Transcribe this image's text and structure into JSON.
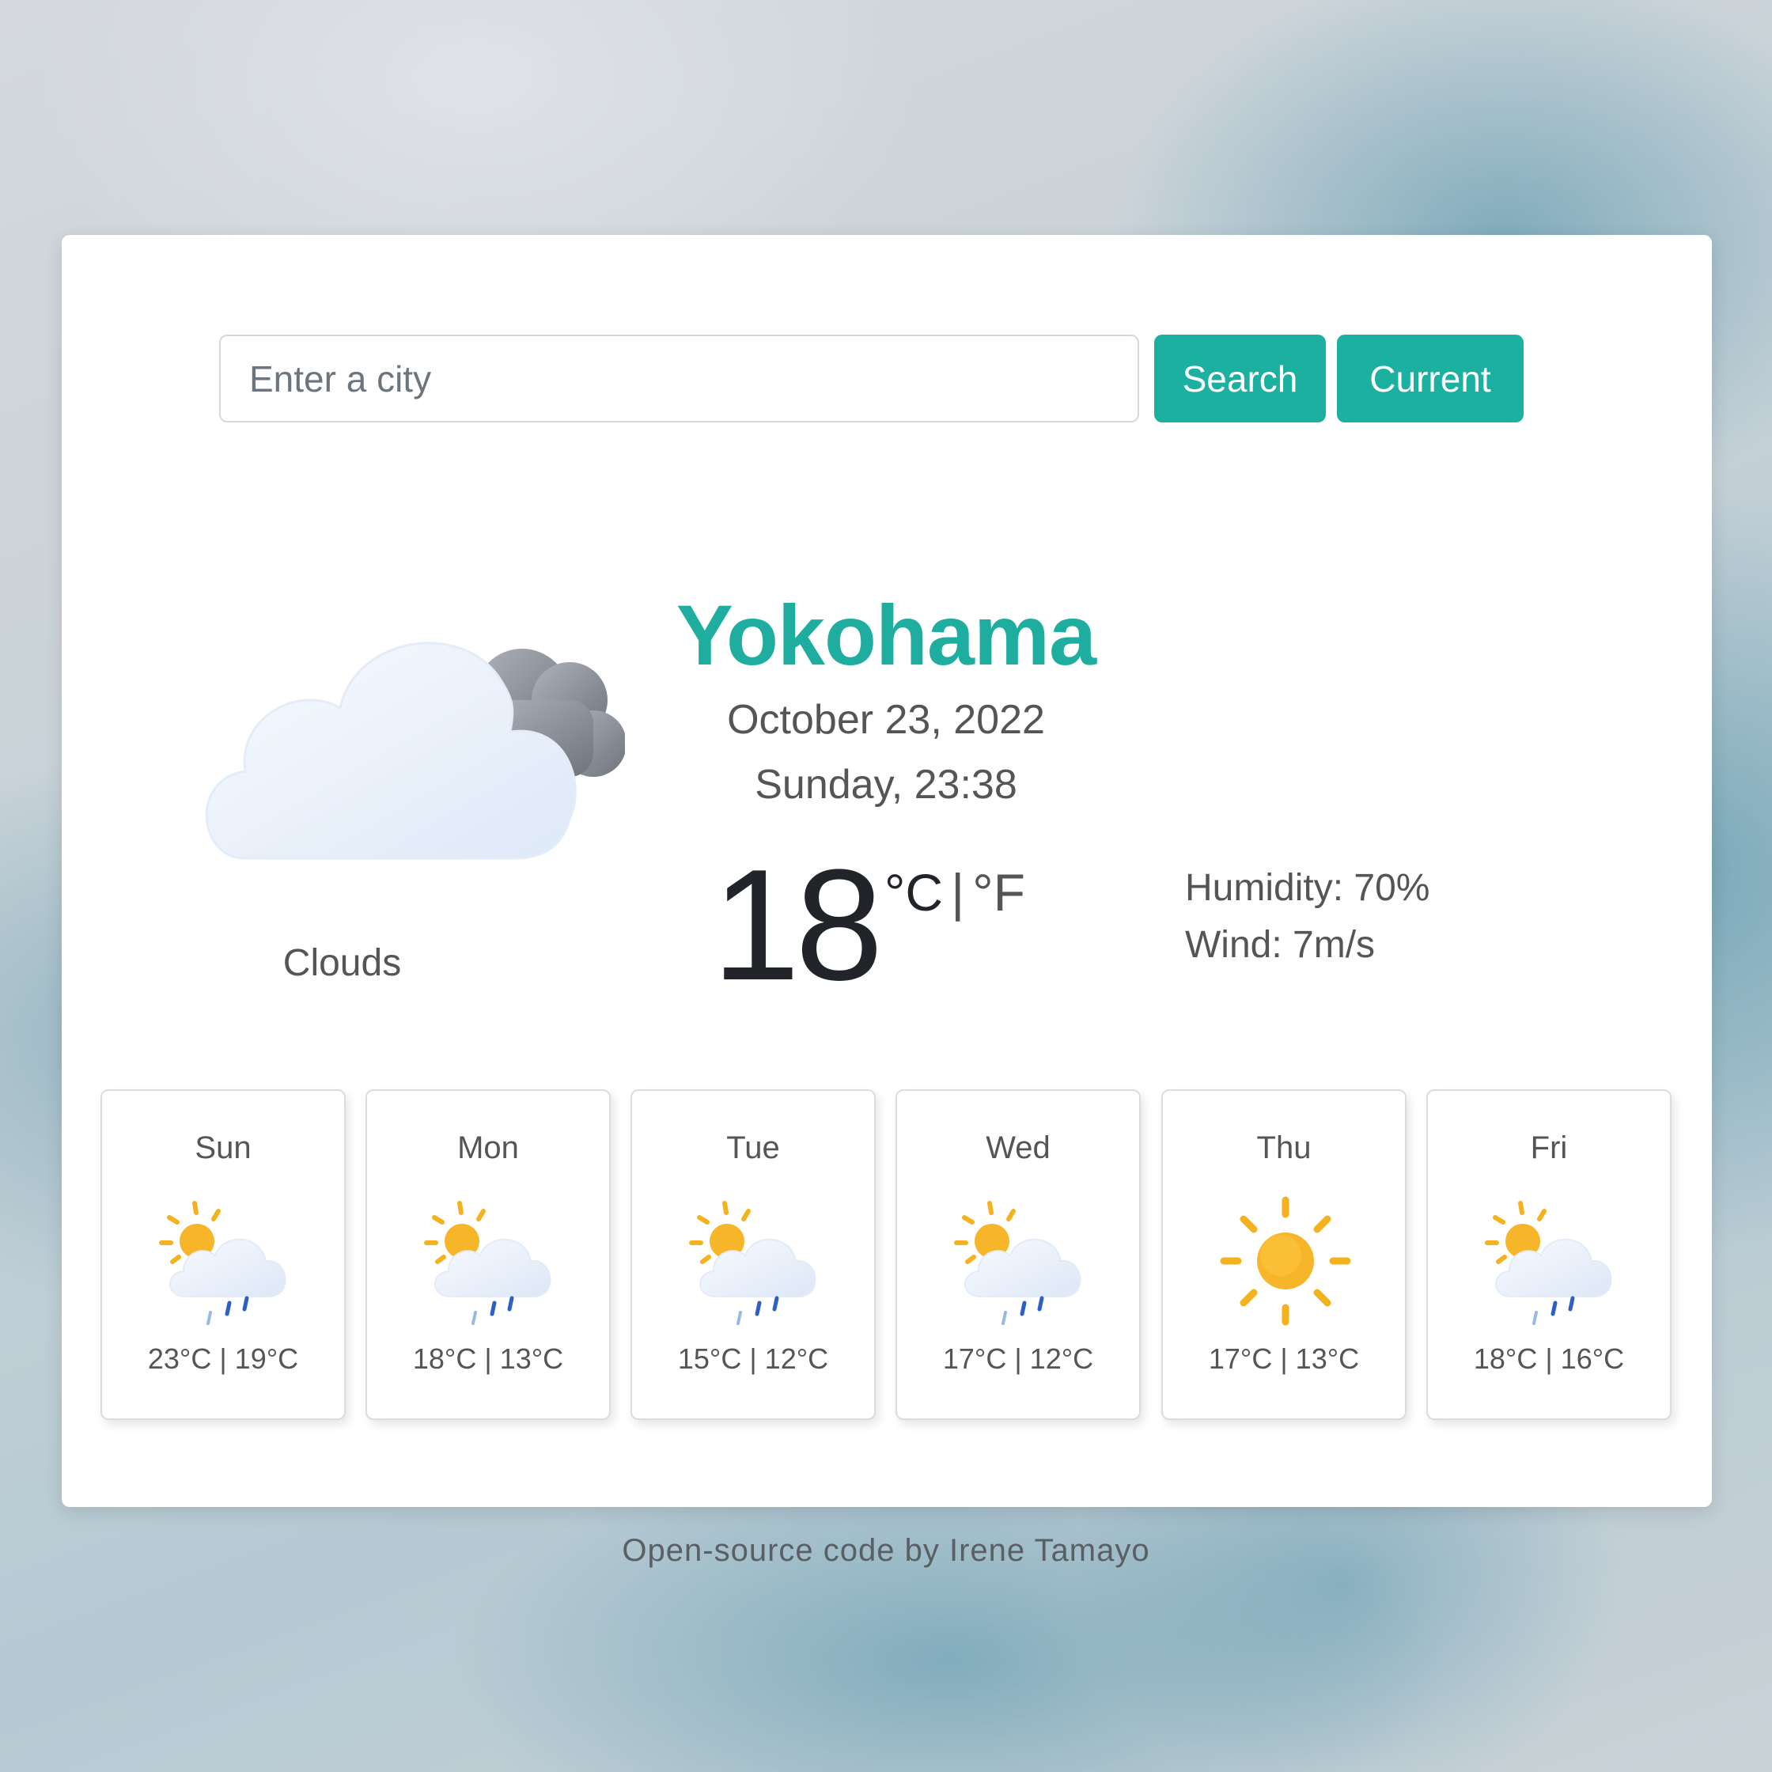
{
  "search": {
    "placeholder": "Enter a city",
    "search_label": "Search",
    "current_label": "Current"
  },
  "current": {
    "icon": "clouds-icon",
    "description": "Clouds",
    "city": "Yokohama",
    "date": "October 23, 2022",
    "day_time": "Sunday, 23:38",
    "temperature": "18",
    "unit_c": "°C",
    "separator": "|",
    "unit_f": "°F",
    "humidity": "Humidity: 70%",
    "wind": "Wind: 7m/s"
  },
  "forecast": [
    {
      "day": "Sun",
      "icon": "sun-rain-icon",
      "temps": "23°C | 19°C"
    },
    {
      "day": "Mon",
      "icon": "sun-rain-icon",
      "temps": "18°C | 13°C"
    },
    {
      "day": "Tue",
      "icon": "sun-rain-icon",
      "temps": "15°C | 12°C"
    },
    {
      "day": "Wed",
      "icon": "sun-rain-icon",
      "temps": "17°C | 12°C"
    },
    {
      "day": "Thu",
      "icon": "sun-icon",
      "temps": "17°C | 13°C"
    },
    {
      "day": "Fri",
      "icon": "sun-rain-icon",
      "temps": "18°C | 16°C"
    }
  ],
  "footer": "Open-source code by Irene Tamayo",
  "colors": {
    "accent": "#1cb0a0",
    "city": "#1fad9f",
    "card": "#ffffff"
  }
}
